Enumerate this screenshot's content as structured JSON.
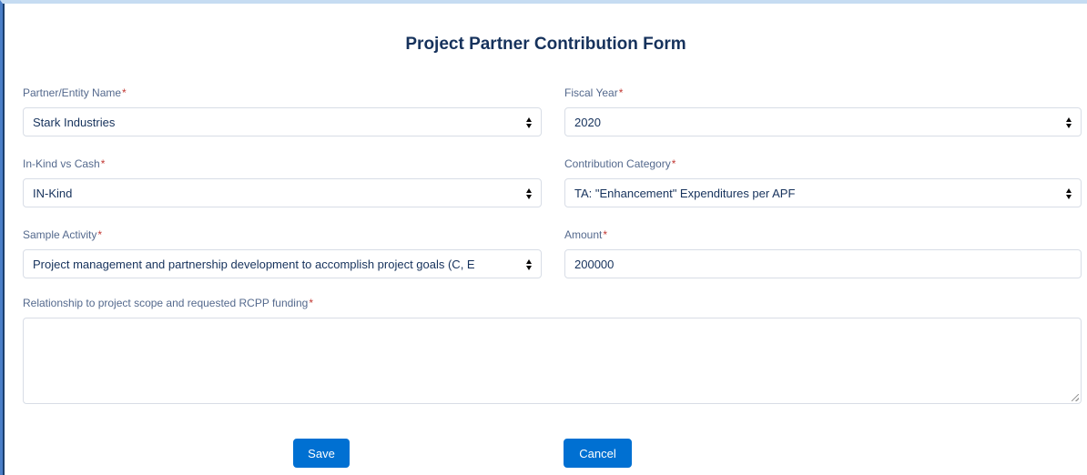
{
  "form": {
    "title": "Project Partner Contribution Form"
  },
  "fields": {
    "partner": {
      "label": "Partner/Entity Name",
      "required_mark": "*",
      "value": "Stark Industries"
    },
    "fiscal_year": {
      "label": "Fiscal Year",
      "required_mark": "*",
      "value": "2020"
    },
    "inkind_cash": {
      "label": "In-Kind vs Cash",
      "required_mark": "*",
      "value": "IN-Kind"
    },
    "category": {
      "label": "Contribution Category",
      "required_mark": "*",
      "value": "TA: \"Enhancement\" Expenditures per APF"
    },
    "sample_activity": {
      "label": "Sample Activity",
      "required_mark": "*",
      "value": "Project management and partnership development to accomplish project goals (C, E"
    },
    "amount": {
      "label": "Amount",
      "required_mark": "*",
      "value": "200000"
    },
    "relationship": {
      "label": "Relationship to project scope and requested RCPP funding",
      "required_mark": "*",
      "value": ""
    }
  },
  "buttons": {
    "save_label": "Save",
    "cancel_label": "Cancel"
  },
  "colors": {
    "primary_button": "#0070d2",
    "title_text": "#16325c",
    "required_asterisk": "#c23934"
  }
}
